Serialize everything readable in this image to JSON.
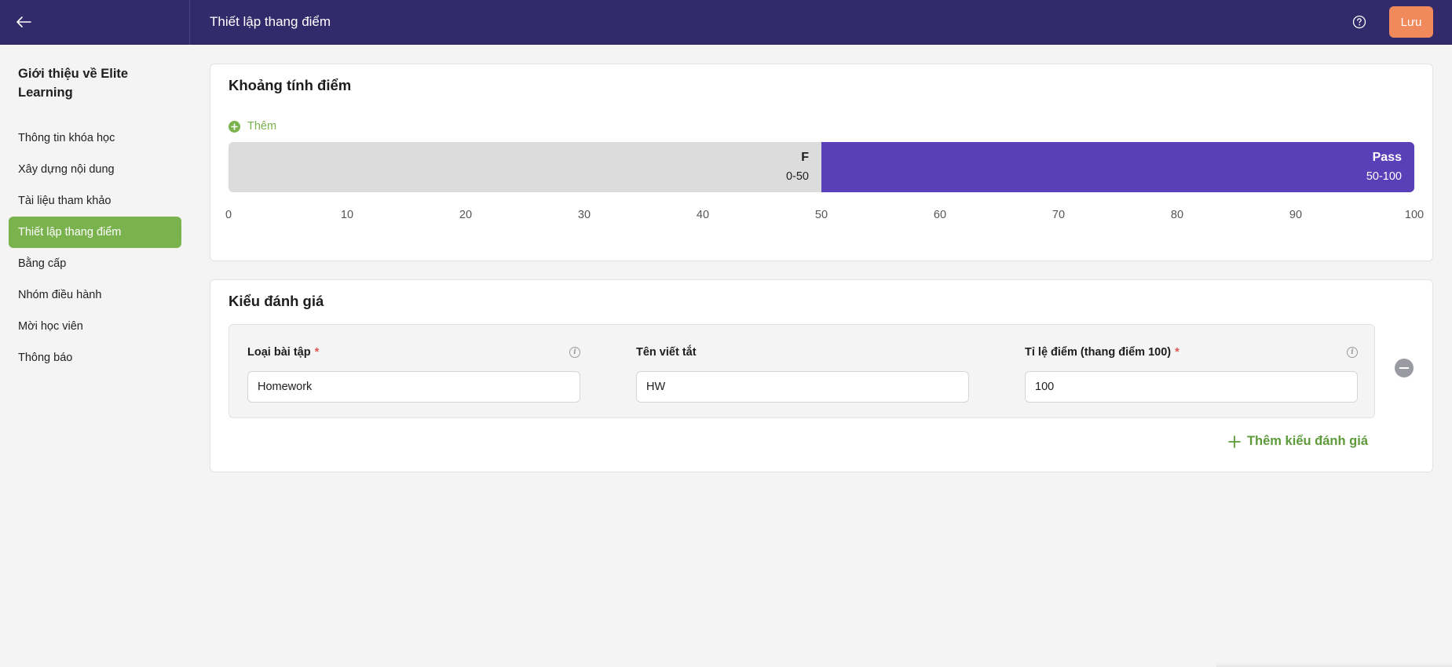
{
  "header": {
    "title": "Thiết lập thang điểm",
    "save_label": "Lưu"
  },
  "sidebar": {
    "course_title": "Giới thiệu về Elite Learning",
    "items": [
      {
        "label": "Thông tin khóa học"
      },
      {
        "label": "Xây dựng nội dung"
      },
      {
        "label": "Tài liệu tham khảo"
      },
      {
        "label": "Thiết lập thang điểm",
        "active": true
      },
      {
        "label": "Bằng cấp"
      },
      {
        "label": "Nhóm điều hành"
      },
      {
        "label": "Mời học viên"
      },
      {
        "label": "Thông báo"
      }
    ]
  },
  "grading_range": {
    "title": "Khoảng tính điểm",
    "add_label": "Thêm",
    "segments": [
      {
        "grade": "F",
        "range": "0-50",
        "from": 0,
        "to": 50,
        "color": "#dcdcdc"
      },
      {
        "grade": "Pass",
        "range": "50-100",
        "from": 50,
        "to": 100,
        "color": "#5a40b8"
      }
    ],
    "scale": [
      "0",
      "10",
      "20",
      "30",
      "40",
      "50",
      "60",
      "70",
      "80",
      "90",
      "100"
    ]
  },
  "assessment_types": {
    "title": "Kiểu đánh giá",
    "fields": {
      "type_label": "Loại bài tập",
      "type_value": "Homework",
      "abbr_label": "Tên viết tắt",
      "abbr_value": "HW",
      "ratio_label": "Tỉ lệ điểm (thang điểm 100)",
      "ratio_value": "100"
    },
    "required_mark": "*",
    "add_type_label": "Thêm kiểu đánh giá"
  },
  "colors": {
    "topbar": "#322a6a",
    "accent_green": "#7ab24e",
    "save_orange": "#f08a5d",
    "pass_purple": "#5a40b8"
  },
  "icons": {
    "back": "arrow-left-icon",
    "help": "question-circle-icon",
    "add": "plus-circle-icon",
    "info": "info-icon",
    "remove": "minus-circle-icon",
    "add_type": "plus-icon"
  }
}
